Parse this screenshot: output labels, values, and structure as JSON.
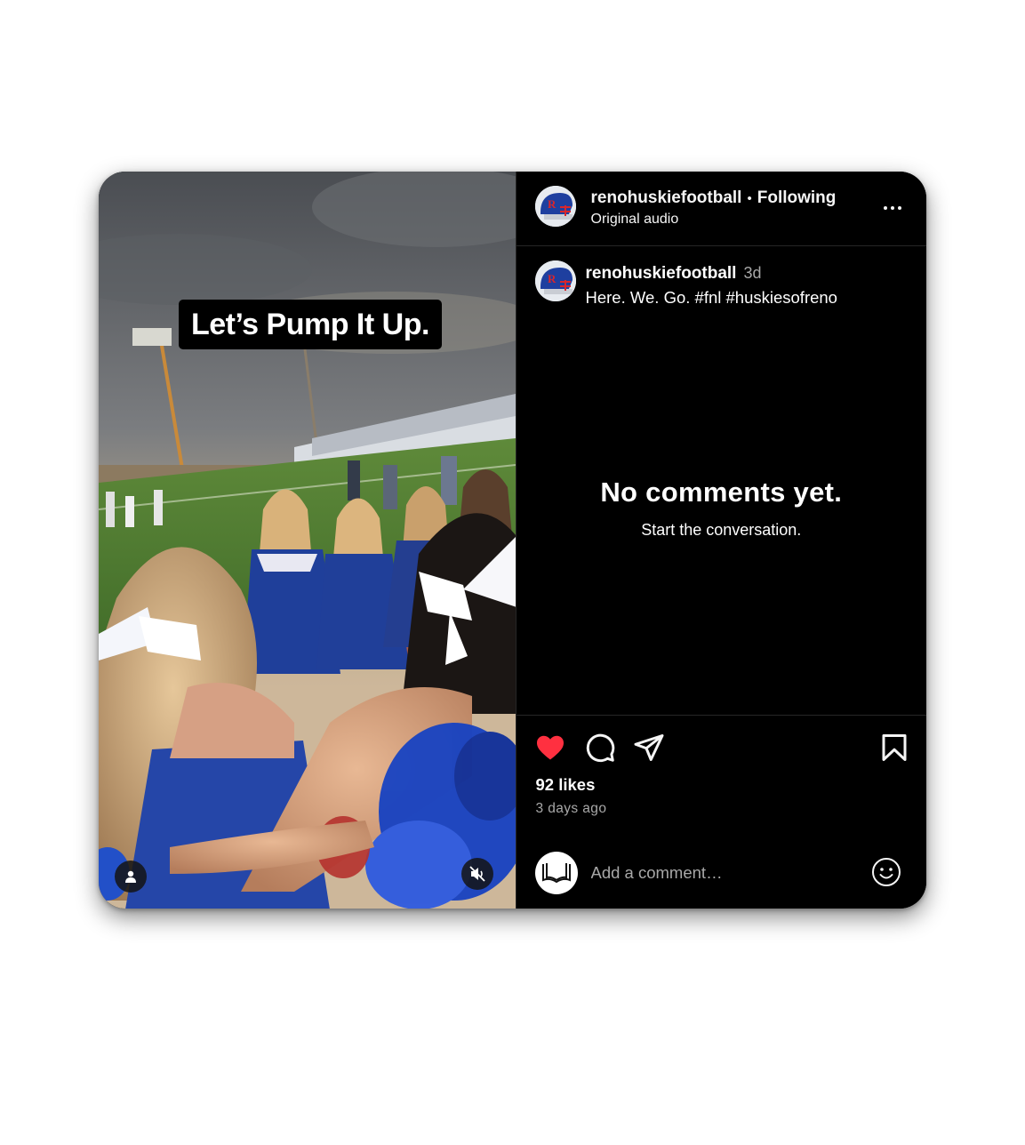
{
  "video": {
    "caption": "Let’s Pump It Up.",
    "user_tag_icon": "person-icon",
    "mute_icon": "speaker-muted-icon"
  },
  "header": {
    "username": "renohuskiefootball",
    "separator": "•",
    "follow_status": "Following",
    "audio": "Original audio",
    "more_icon": "ellipsis-icon"
  },
  "caption_post": {
    "username": "renohuskiefootball",
    "age": "3d",
    "text": "Here. We. Go. #fnl #huskiesofreno"
  },
  "comments": {
    "empty_title": "No comments yet.",
    "empty_subtitle": "Start the conversation."
  },
  "actions": {
    "like_icon": "heart-filled-icon",
    "comment_icon": "comment-bubble-icon",
    "share_icon": "paper-plane-icon",
    "save_icon": "bookmark-icon",
    "likes": "92 likes",
    "posted_ago": "3 days ago"
  },
  "comment_box": {
    "placeholder": "Add a comment…",
    "emoji_icon": "smiley-icon"
  },
  "colors": {
    "like_red": "#ff3040",
    "panel_bg": "#000000",
    "secondary_text": "#a8a8a8"
  }
}
